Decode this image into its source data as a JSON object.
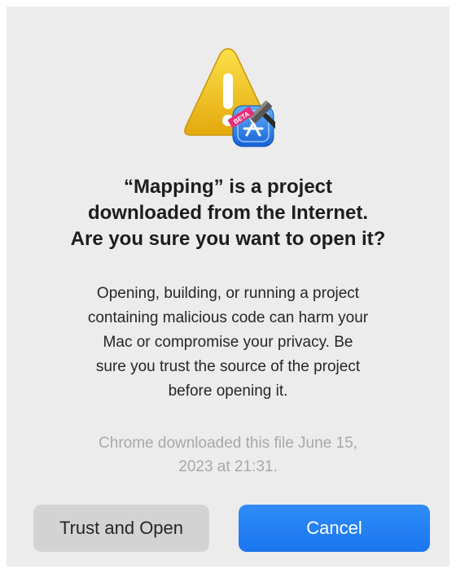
{
  "dialog": {
    "icon": "xcode-beta-warning-icon",
    "badge_text": "BETA",
    "title_lines": [
      "“Mapping” is a project",
      "downloaded from the Internet.",
      "Are you sure you want to open it?"
    ],
    "message_lines": [
      "Opening, building, or running a project",
      "containing malicious code can harm your",
      "Mac or compromise your privacy. Be",
      "sure you trust the source of the project",
      "before opening it."
    ],
    "note_lines": [
      "Chrome downloaded this file June 15,",
      "2023 at 21:31."
    ],
    "buttons": {
      "trust_label": "Trust and Open",
      "cancel_label": "Cancel"
    }
  },
  "colors": {
    "dialog_background": "#ececec",
    "warning_yellow": "#f2c51b",
    "accent_blue": "#1f7ff3",
    "secondary_button": "#d3d3d3",
    "note_text": "#a8a8a8"
  }
}
